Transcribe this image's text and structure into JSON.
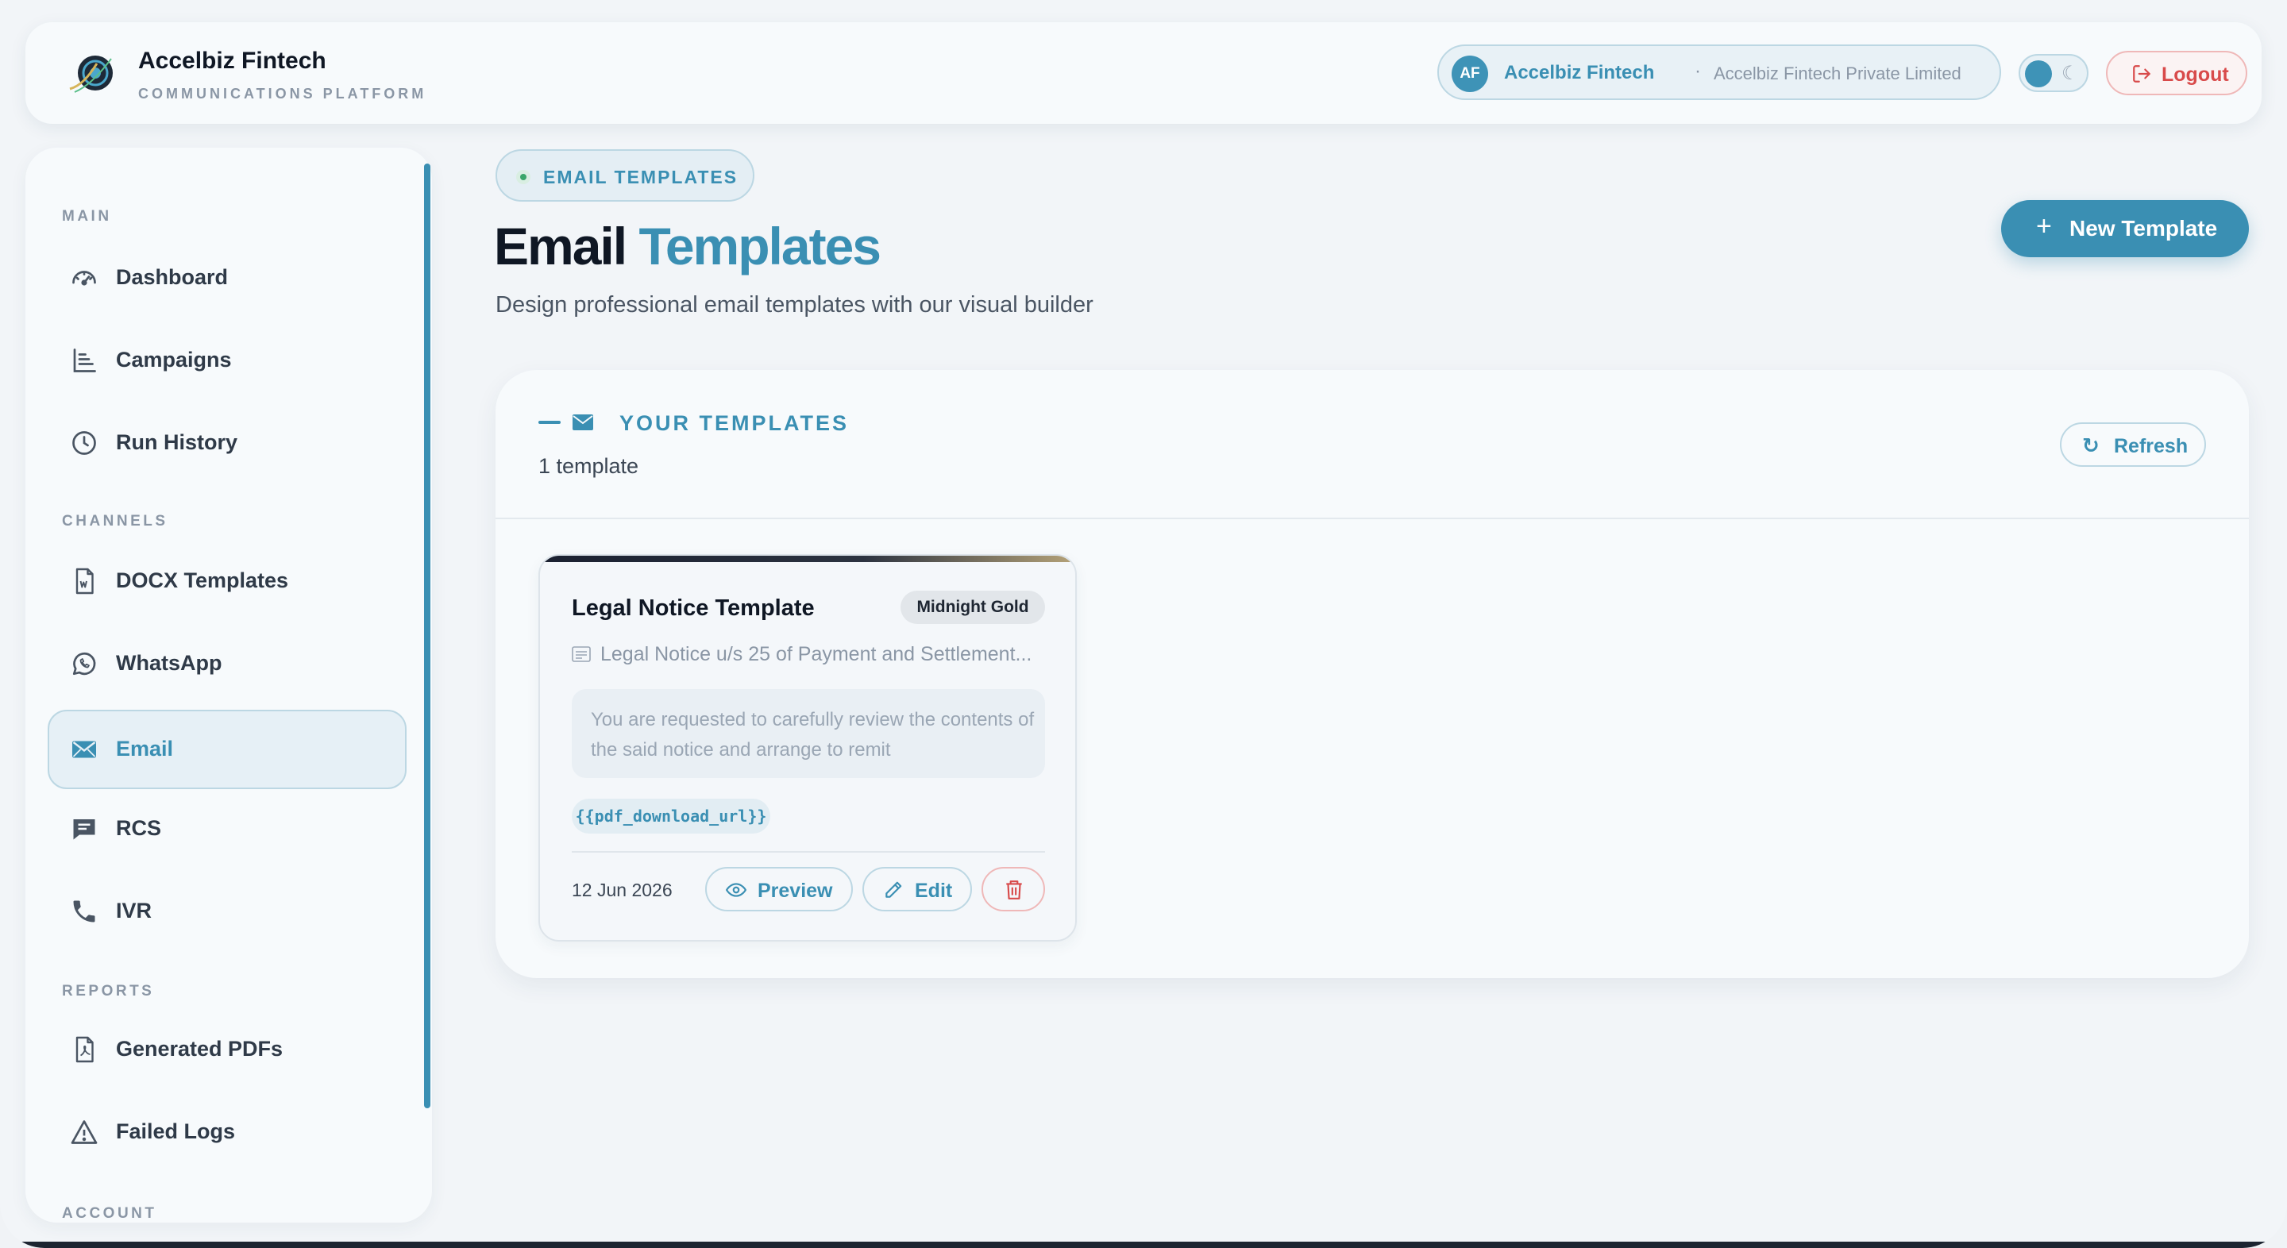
{
  "header": {
    "brand_title": "Accelbiz Fintech",
    "brand_subtitle": "COMMUNICATIONS PLATFORM",
    "org_initials": "AF",
    "org_name": "Accelbiz Fintech",
    "org_separator": "·",
    "org_legal_name": "Accelbiz Fintech Private Limited",
    "logout_label": "Logout"
  },
  "sidebar": {
    "sections": {
      "main": "MAIN",
      "channels": "CHANNELS",
      "reports": "REPORTS",
      "account": "ACCOUNT"
    },
    "items": [
      {
        "label": "Dashboard",
        "icon": "dashboard-gauge-icon"
      },
      {
        "label": "Campaigns",
        "icon": "campaigns-list-icon"
      },
      {
        "label": "Run History",
        "icon": "clock-history-icon"
      },
      {
        "label": "DOCX Templates",
        "icon": "word-document-icon"
      },
      {
        "label": "WhatsApp",
        "icon": "whatsapp-icon"
      },
      {
        "label": "Email",
        "icon": "envelope-icon",
        "active": true
      },
      {
        "label": "RCS",
        "icon": "chat-message-icon"
      },
      {
        "label": "IVR",
        "icon": "phone-icon"
      },
      {
        "label": "Generated PDFs",
        "icon": "pdf-file-icon"
      },
      {
        "label": "Failed Logs",
        "icon": "warning-triangle-icon"
      }
    ]
  },
  "main": {
    "eyebrow": "EMAIL TEMPLATES",
    "title_part1": "Email",
    "title_part2": "Templates",
    "subtitle": "Design professional email templates with our visual builder",
    "new_button": "New Template",
    "new_button_icon": "+",
    "panel": {
      "title": "YOUR TEMPLATES",
      "count": "1 template",
      "refresh_label": "Refresh",
      "refresh_icon": "↻"
    },
    "templates": [
      {
        "name": "Legal Notice Template",
        "theme": "Midnight Gold",
        "subject": "Legal Notice u/s 25 of Payment and Settlement...",
        "preview": "You are requested to carefully review the contents of the said notice and arrange to remit",
        "variable": "{{pdf_download_url}}",
        "date": "12 Jun 2026",
        "preview_label": "Preview",
        "edit_label": "Edit"
      }
    ]
  },
  "colors": {
    "accent": "#3a8fb3",
    "danger": "#d84a4a",
    "background": "#f2f5f8",
    "surface": "#f7fafc",
    "text_dark": "#0f1724"
  }
}
